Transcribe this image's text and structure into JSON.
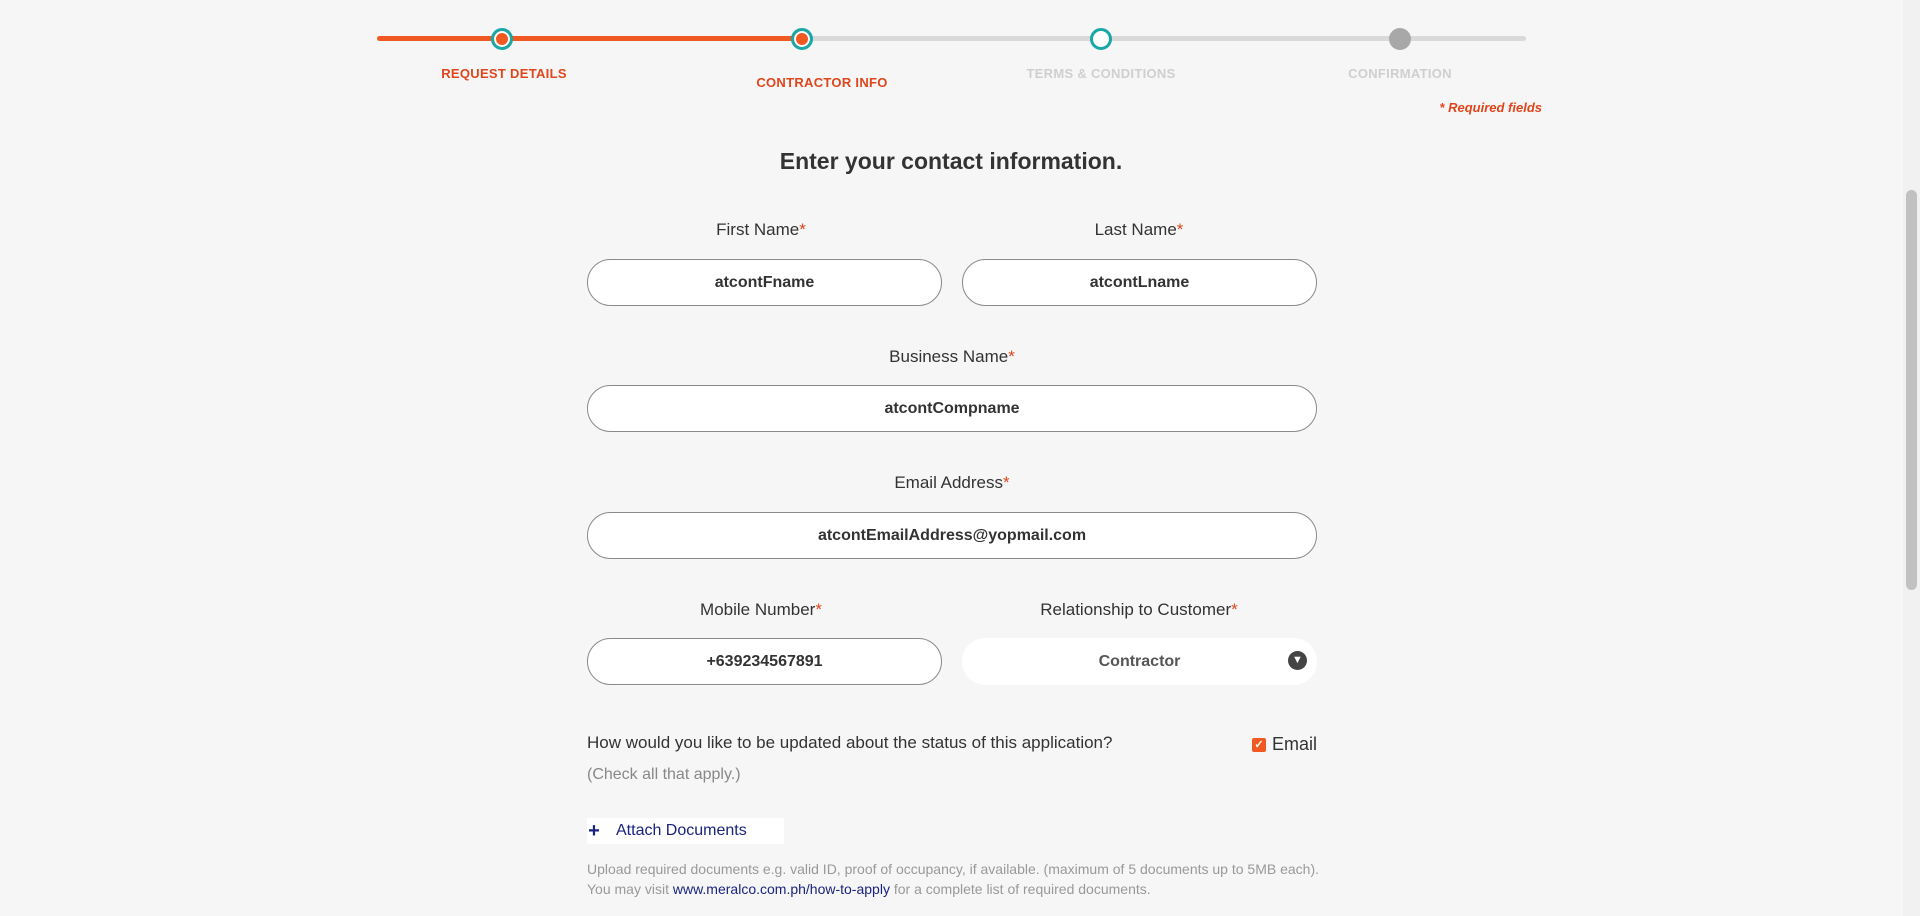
{
  "stepper": {
    "steps": [
      {
        "label": "REQUEST DETAILS",
        "state": "done"
      },
      {
        "label": "CONTRACTOR INFO",
        "state": "current"
      },
      {
        "label": "TERMS & CONDITIONS",
        "state": "upcoming"
      },
      {
        "label": "CONFIRMATION",
        "state": "upcoming"
      }
    ],
    "accent_color": "#f05a22",
    "ring_color": "#1aa7a6"
  },
  "required_note": "* Required fields",
  "heading": "Enter your contact information.",
  "form": {
    "first_name": {
      "label": "First Name",
      "value": "atcontFname"
    },
    "last_name": {
      "label": "Last Name",
      "value": "atcontLname"
    },
    "business_name": {
      "label": "Business Name",
      "value": "atcontCompname"
    },
    "email": {
      "label": "Email Address",
      "value": "atcontEmailAddress@yopmail.com"
    },
    "mobile": {
      "label": "Mobile Number",
      "value": "+639234567891"
    },
    "relationship": {
      "label": "Relationship to Customer",
      "value": "Contractor"
    },
    "required_mark": "*"
  },
  "updates": {
    "question": "How would you like to be updated about the status of this application?",
    "hint": "(Check all that apply.)",
    "email_option": {
      "label": "Email",
      "checked": true
    }
  },
  "attach": {
    "label": "Attach Documents",
    "icon": "plus-icon"
  },
  "upload_note": {
    "line1": "Upload required documents e.g. valid ID, proof of occupancy, if available. (maximum of 5 documents up to 5MB each).",
    "line2_prefix": "You may visit ",
    "link": "www.meralco.com.ph/how-to-apply",
    "line2_suffix": " for a complete list of required documents."
  }
}
